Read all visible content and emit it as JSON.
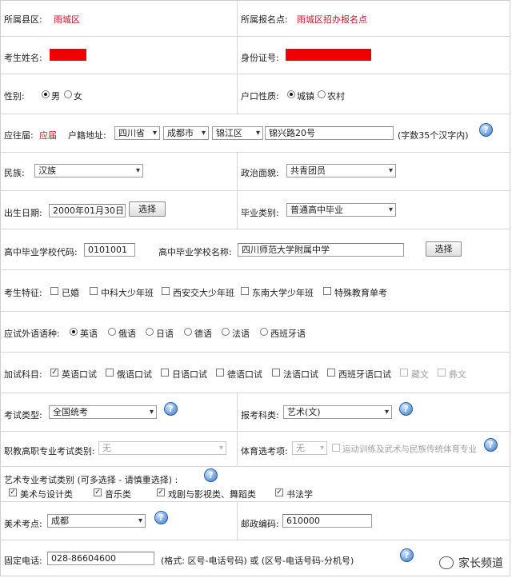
{
  "county": {
    "label": "所属县区:",
    "value": "雨城区"
  },
  "reg_point": {
    "label": "所属报名点:",
    "value": "雨城区招办报名点"
  },
  "name": {
    "label": "考生姓名:"
  },
  "id_no": {
    "label": "身份证号:"
  },
  "gender": {
    "label": "性别:",
    "options": [
      "男",
      "女"
    ],
    "selected": "男"
  },
  "hukou_type": {
    "label": "户口性质:",
    "options": [
      "城镇",
      "农村"
    ],
    "selected": "城镇"
  },
  "grad_year": {
    "label": "应往届:",
    "value": "应届"
  },
  "address": {
    "label": "户籍地址:",
    "province": "四川省",
    "city": "成都市",
    "district": "锦江区",
    "street": "锦兴路20号",
    "hint": "(字数35个汉字内)"
  },
  "ethnicity": {
    "label": "民族:",
    "value": "汉族"
  },
  "political": {
    "label": "政治面貌:",
    "value": "共青团员"
  },
  "birth": {
    "label": "出生日期:",
    "value": "2000年01月30日",
    "button": "选择"
  },
  "grad_type": {
    "label": "毕业类别:",
    "value": "普通高中毕业"
  },
  "school": {
    "code_label": "高中毕业学校代码:",
    "code": "0101001",
    "name_label": "高中毕业学校名称:",
    "name": "四川师范大学附属中学",
    "button": "选择"
  },
  "features": {
    "label": "考生特征:",
    "options": [
      "已婚",
      "中科大少年班",
      "西安交大少年班",
      "东南大学少年班",
      "特殊教育单考"
    ]
  },
  "language": {
    "label": "应试外语语种:",
    "options": [
      "英语",
      "俄语",
      "日语",
      "德语",
      "法语",
      "西班牙语"
    ],
    "selected": "英语"
  },
  "extra_subjects": {
    "label": "加试科目:",
    "options": [
      "英语口试",
      "俄语口试",
      "日语口试",
      "德语口试",
      "法语口试",
      "西班牙语口试",
      "藏文",
      "彝文"
    ],
    "checked": [
      "英语口试"
    ],
    "disabled": [
      "藏文",
      "彝文"
    ]
  },
  "exam_type": {
    "label": "考试类型:",
    "value": "全国统考"
  },
  "subject_cat": {
    "label": "报考科类:",
    "value": "艺术(文)"
  },
  "vocational": {
    "label": "职教高职专业考试类别:",
    "value": "无"
  },
  "sports": {
    "label": "体育选考项:",
    "value": "无",
    "checkbox_label": "运动训练及武术与民族传统体育专业"
  },
  "art": {
    "label": "艺术专业考试类别 (可多选择 - 请慎重选择) :",
    "options": [
      "美术与设计类",
      "音乐类",
      "戏剧与影视类、舞蹈类",
      "书法学"
    ],
    "checked": [
      "美术与设计类",
      "音乐类",
      "戏剧与影视类、舞蹈类",
      "书法学"
    ]
  },
  "art_site": {
    "label": "美术考点:",
    "value": "成都"
  },
  "postcode": {
    "label": "邮政编码:",
    "value": "610000"
  },
  "phone": {
    "label": "固定电话:",
    "value": "028-86604600",
    "hint": "(格式: 区号-电话号码) 或 (区号-电话号码-分机号)"
  },
  "help_glyph": "?",
  "watermark": "家长频道",
  "colors": {
    "accent_red": "#b8202a",
    "redaction": "#f00000",
    "border": "#d6d6d6"
  }
}
